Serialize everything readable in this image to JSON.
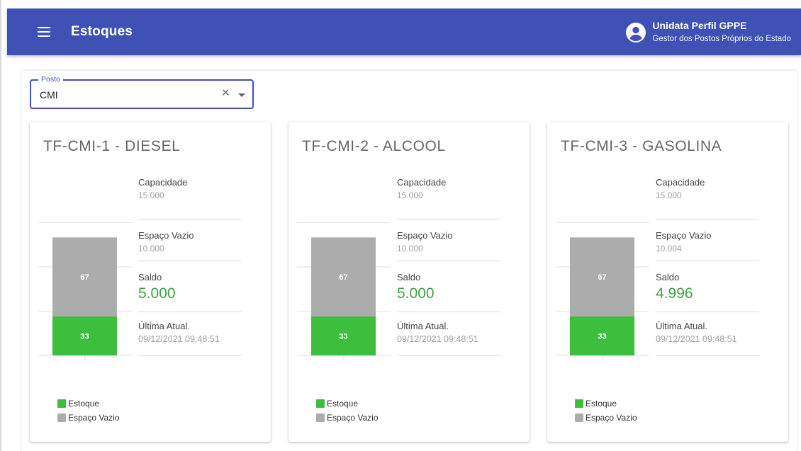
{
  "header": {
    "title": "Estoques",
    "user_name": "Unidata Perfil GPPE",
    "user_role": "Gestor dos Postos Próprios do Estado"
  },
  "filter": {
    "label": "Posto",
    "value": "CMI",
    "clear_glyph": "×"
  },
  "labels": {
    "capacidade": "Capacidade",
    "espaco_vazio": "Espaço Vazio",
    "saldo": "Saldo",
    "ultima_atual": "Última Atual."
  },
  "colors": {
    "primary": "#3f51b5",
    "estoque": "#3dbe3d",
    "vazio": "#acacac",
    "saldo": "#43a047"
  },
  "icons": {
    "menu": "menu-icon",
    "user": "account-circle-icon",
    "clear": "close-icon",
    "dropdown": "chevron-down-icon"
  },
  "chart_data": [
    {
      "type": "bar",
      "title": "TF-CMI-1 - DIESEL",
      "categories": [
        ""
      ],
      "stacked": true,
      "ylim": [
        0,
        150
      ],
      "series": [
        {
          "name": "Estoque",
          "values": [
            33
          ],
          "color": "#3dbe3d"
        },
        {
          "name": "Espaço Vazio",
          "values": [
            67
          ],
          "color": "#acacac"
        }
      ],
      "legend": "bottom-left"
    },
    {
      "type": "bar",
      "title": "TF-CMI-2 - ALCOOL",
      "categories": [
        ""
      ],
      "stacked": true,
      "ylim": [
        0,
        150
      ],
      "series": [
        {
          "name": "Estoque",
          "values": [
            33
          ],
          "color": "#3dbe3d"
        },
        {
          "name": "Espaço Vazio",
          "values": [
            67
          ],
          "color": "#acacac"
        }
      ],
      "legend": "bottom-left"
    },
    {
      "type": "bar",
      "title": "TF-CMI-3 - GASOLINA",
      "categories": [
        ""
      ],
      "stacked": true,
      "ylim": [
        0,
        150
      ],
      "series": [
        {
          "name": "Estoque",
          "values": [
            33
          ],
          "color": "#3dbe3d"
        },
        {
          "name": "Espaço Vazio",
          "values": [
            67
          ],
          "color": "#acacac"
        }
      ],
      "legend": "bottom-left"
    }
  ],
  "tanks": [
    {
      "title": "TF-CMI-1 - DIESEL",
      "capacidade": "15.000",
      "espaco_vazio": "10.000",
      "saldo": "5.000",
      "ultima_atual": "09/12/2021 09:48:51"
    },
    {
      "title": "TF-CMI-2 - ALCOOL",
      "capacidade": "15.000",
      "espaco_vazio": "10.000",
      "saldo": "5.000",
      "ultima_atual": "09/12/2021 09:48:51"
    },
    {
      "title": "TF-CMI-3 - GASOLINA",
      "capacidade": "15.000",
      "espaco_vazio": "10.004",
      "saldo": "4.996",
      "ultima_atual": "09/12/2021 09:48:51"
    }
  ]
}
